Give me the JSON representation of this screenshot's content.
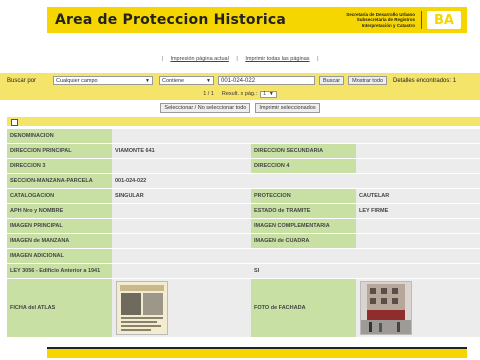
{
  "header": {
    "title": "Area de Proteccion Historica",
    "org_lines": [
      "Secretaría de Desarrollo Urbano",
      "Subsecretaría de Registros",
      "Interpretación y Catastro"
    ],
    "logo_text": "BA"
  },
  "links": {
    "print_current": "Impresión página actual",
    "print_all": "Imprimir todas las páginas",
    "separator": "|"
  },
  "search": {
    "label": "Buscar por",
    "field": "Cualquier campo",
    "operator": "Contiene",
    "value": "001-024-022",
    "search_button": "Buscar",
    "show_all_button": "Mostrar todo",
    "found_text": "Detalles encontrados: 1"
  },
  "pagination": {
    "page_text": "1 / 1",
    "per_page_label": "Result. x pág.:",
    "per_page_value": "1"
  },
  "actions": {
    "select_toggle": "Seleccionar / No seleccionar todo",
    "print_selected": "Imprimir seleccionados"
  },
  "record": {
    "denominacion_label": "DENOMINACION",
    "denominacion_value": "",
    "direccion_principal_label": "DIRECCION PRINCIPAL",
    "direccion_principal_value": "VIAMONTE 641",
    "direccion_secundaria_label": "DIRECCION SECUNDARIA",
    "direccion_secundaria_value": "",
    "direccion3_label": "DIRECCION 3",
    "direccion3_value": "",
    "direccion4_label": "DIRECCION 4",
    "direccion4_value": "",
    "smp_label": "SECCION-MANZANA-PARCELA",
    "smp_value": "001-024-022",
    "catalogacion_label": "CATALOGACION",
    "catalogacion_value": "SINGULAR",
    "proteccion_label": "PROTECCION",
    "proteccion_value": "CAUTELAR",
    "aph_label": "APH Nro y NOMBRE",
    "aph_value": "",
    "estado_label": "ESTADO de TRAMITE",
    "estado_value": "LEY FIRME",
    "img_principal_label": "IMAGEN PRINCIPAL",
    "img_complementaria_label": "IMAGEN COMPLEMENTARIA",
    "img_manzana_label": "IMAGEN de MANZANA",
    "img_cuadra_label": "IMAGEN de CUADRA",
    "img_adicional_label": "IMAGEN ADICIONAL",
    "ley_label": "LEY 3056 - Edificio Anterior a 1941",
    "ley_value": "SI",
    "ficha_label": "FICHA del ATLAS",
    "foto_label": "FOTO de FACHADA"
  },
  "colors": {
    "brand_yellow": "#f5d600",
    "bar_yellow": "#f5e46a",
    "label_green": "#c8e0a4",
    "value_gray": "#ececec"
  }
}
